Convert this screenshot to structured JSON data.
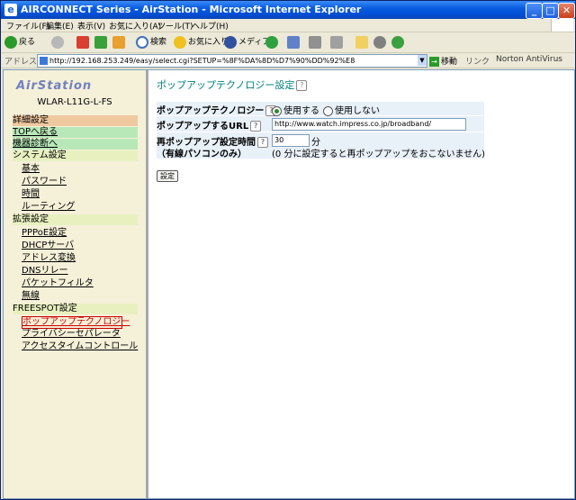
{
  "window": {
    "title": "AIRCONNECT Series - AirStation - Microsoft Internet Explorer",
    "minimize": "_",
    "maximize": "□",
    "close": "✕"
  },
  "menubar": [
    "ファイル(F)",
    "編集(E)",
    "表示(V)",
    "お気に入り(A)",
    "ツール(T)",
    "ヘルプ(H)"
  ],
  "toolbar": {
    "back": "戻る",
    "search": "検索",
    "favorites": "お気に入り",
    "media": "メディア"
  },
  "address": {
    "label": "アドレス(D)",
    "url": "http://192.168.253.249/easy/select.cgi?SETUP=%8F%DA%8D%D7%90%DD%92%E8",
    "go": "移動",
    "links": "リンク",
    "norton": "Norton AntiVirus"
  },
  "sidebar": {
    "logo": "AirStation",
    "model": "WLAR-L11G-L-FS",
    "items": [
      {
        "label": "詳細設定",
        "style": "bg-orange"
      },
      {
        "label": "TOPへ戻る",
        "style": "bg-green link"
      },
      {
        "label": "機器診断へ",
        "style": "bg-green link"
      },
      {
        "label": "システム設定",
        "style": "bg-cream"
      },
      {
        "label": "基本",
        "style": "bg-pale indent link"
      },
      {
        "label": "パスワード",
        "style": "bg-pale indent link"
      },
      {
        "label": "時間",
        "style": "bg-pale indent link"
      },
      {
        "label": "ルーティング",
        "style": "bg-pale indent link"
      },
      {
        "label": "拡張設定",
        "style": "bg-cream"
      },
      {
        "label": "PPPoE設定",
        "style": "bg-pale indent link"
      },
      {
        "label": "DHCPサーバ",
        "style": "bg-pale indent link"
      },
      {
        "label": "アドレス変換",
        "style": "bg-pale indent link"
      },
      {
        "label": "DNSリレー",
        "style": "bg-pale indent link"
      },
      {
        "label": "パケットフィルタ",
        "style": "bg-pale indent link"
      },
      {
        "label": "無線",
        "style": "bg-pale indent link"
      },
      {
        "label": "FREESPOT設定",
        "style": "bg-cream"
      },
      {
        "label": "ポップアップテクノロジー",
        "style": "active link"
      },
      {
        "label": "プライバシーセパレータ",
        "style": "bg-pale indent link"
      },
      {
        "label": "アクセスタイムコントロール",
        "style": "bg-pale indent link"
      }
    ]
  },
  "main": {
    "title": "ポップアップテクノロジー設定",
    "help": "?",
    "rows": {
      "popup_tech_label": "ポップアップテクノロジー",
      "radio_on": "使用する",
      "radio_off": "使用しない",
      "popup_url_label": "ポップアップするURL",
      "popup_url_value": "http://www.watch.impress.co.jp/broadband/",
      "repopup_label_1": "再ポップアップ設定時間",
      "repopup_label_2": "（有線パソコンのみ）",
      "repopup_value": "30",
      "repopup_unit": "分",
      "repopup_note": "(0 分に設定すると再ポップアップをおこないません)"
    },
    "submit": "設定"
  }
}
